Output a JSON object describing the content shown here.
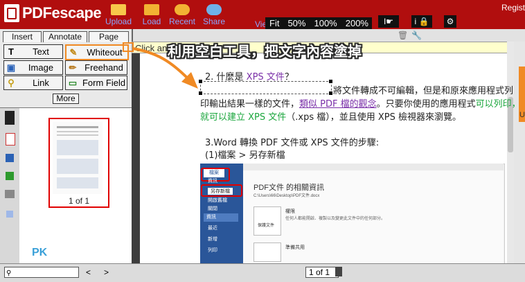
{
  "app": {
    "brand": "PDFescape",
    "register": "Regist"
  },
  "toolbar": {
    "buttons": [
      {
        "label": "Upload",
        "icon": "upload-icon"
      },
      {
        "label": "Load",
        "icon": "folder-icon"
      },
      {
        "label": "Recent",
        "icon": "recent-icon"
      },
      {
        "label": "Share",
        "icon": "share-icon"
      }
    ],
    "view_label": "View",
    "zoom": [
      "Fit",
      "50%",
      "100%",
      "200%"
    ]
  },
  "tabs": [
    "Insert",
    "Annotate",
    "Page"
  ],
  "tools": [
    {
      "label": "Text",
      "icon": "text-icon",
      "glyph": "T"
    },
    {
      "label": "Whiteout",
      "icon": "whiteout-icon",
      "glyph": "✎",
      "highlighted": true
    },
    {
      "label": "Image",
      "icon": "image-icon",
      "glyph": "▣"
    },
    {
      "label": "Freehand",
      "icon": "pencil-icon",
      "glyph": "✏"
    },
    {
      "label": "Link",
      "icon": "link-icon",
      "glyph": "⚲"
    },
    {
      "label": "Form Field",
      "icon": "form-field-icon",
      "glyph": "▭"
    }
  ],
  "more_label": "More",
  "click_hint": "Click an",
  "banner": "利用空白工具，把文字內容塗掉",
  "thumbnail": {
    "caption": "1 of 1"
  },
  "document": {
    "line1_prefix": "2. 什麼是 ",
    "line1_link": "XPS 文件",
    "line1_suffix": "？",
    "line2": "將文件轉成不可編輯，但是和原來應用程式列",
    "line3_a": "印輸出結果一樣的文件，",
    "line3_b": "類似 PDF 檔的觀念",
    "line3_c": "。只要你使用的應用程式",
    "line3_d": "可以列印，",
    "line4_a": "就可以建立 XPS 文件",
    "line4_b": "（.xps 檔），並且使用 XPS 檢視器來瀏覽。",
    "heading": "3.Word 轉換 PDF 文件或 XPS 文件的步驟:",
    "subheading": "(1)檔案 > 另存新檔"
  },
  "embedded": {
    "title": "PDF文件 的相關資訊",
    "path": "C:\\Users\\66\\Desktop\\PDF文件.docx",
    "menu": [
      "檔案",
      "資訊",
      "另存新檔",
      "開啟舊檔",
      "關閉",
      "資訊",
      "最近",
      "新增",
      "列印"
    ],
    "perm_label": "權限",
    "perm_text": "任何人都能開啟、複製以及變更此文件中的任何部分。",
    "protect_label": "保護文件",
    "share_label": "準備共用",
    "watermark": "PK"
  },
  "bottom": {
    "page_select": "1 of 1",
    "nav_prev": "<",
    "nav_next": ">"
  },
  "colors": {
    "brand_red": "#b10e0e",
    "accent_orange": "#f08a24",
    "link_purple": "#7a2fa8",
    "link_green": "#1aa63c"
  }
}
